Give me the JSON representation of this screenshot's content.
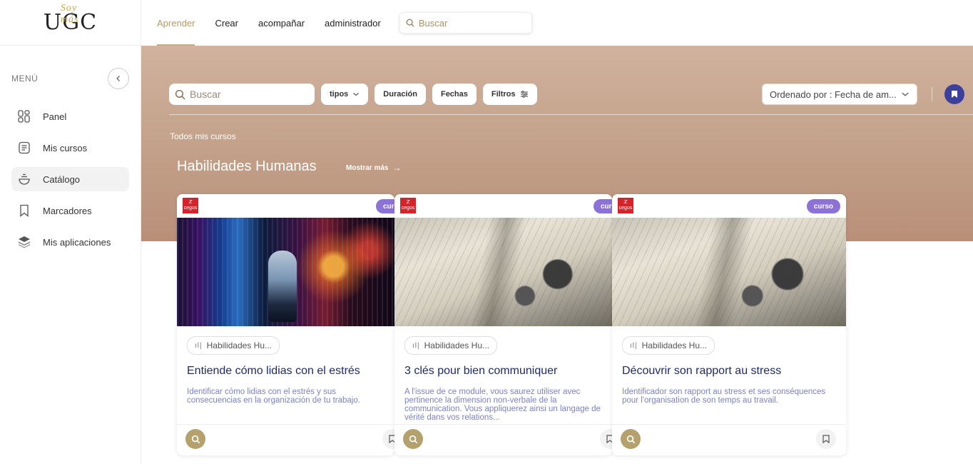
{
  "logo": {
    "letters": "UGC",
    "script": "Soy más"
  },
  "sidebar": {
    "menu_title": "MENÚ",
    "items": [
      {
        "label": "Panel",
        "icon": "dashboard-icon"
      },
      {
        "label": "Mis cursos",
        "icon": "courses-icon"
      },
      {
        "label": "Catálogo",
        "icon": "catalog-icon",
        "active": true
      },
      {
        "label": "Marcadores",
        "icon": "bookmark-icon"
      },
      {
        "label": "Mis aplicaciones",
        "icon": "apps-icon"
      }
    ]
  },
  "topnav": {
    "items": [
      "Aprender",
      "Crear",
      "acompañar",
      "administrador"
    ],
    "active": "Aprender",
    "search_placeholder": "Buscar"
  },
  "filters": {
    "search_placeholder": "Buscar",
    "types": "tipos",
    "duration": "Duración",
    "dates": "Fechas",
    "filters": "Filtros",
    "sort": "Ordenado por : Fecha de am..."
  },
  "section": {
    "all_courses": "Todos mis cursos",
    "title": "Habilidades Humanas",
    "show_more": "Mostrar más"
  },
  "cards": [
    {
      "badge": "curso",
      "category": "Habilidades Hu...",
      "title": "Entiende cómo lidias con el estrés",
      "description": "Identificar cómo lidias con el estrés y sus consecuencias en la organización de tu trabajo."
    },
    {
      "badge": "curso",
      "category": "Habilidades Hu...",
      "title": "3 clés pour bien communiquer",
      "description": "A l'issue de ce module, vous saurez utiliser avec pertinence la dimension non-verbale de la communication. Vous appliquerez ainsi un langage de vérité dans vos relations..."
    },
    {
      "badge": "curso",
      "category": "Habilidades Hu...",
      "title": "Découvrir son rapport au stress",
      "description": "Identificador son rapport au stress et ses conséquences pour l'organisation de son temps au travail."
    }
  ],
  "brand_badge": {
    "line1": "ℤ",
    "line2": "cegos"
  },
  "colors": {
    "accent_gold": "#b5a16e",
    "primary_navy": "#3d3f9c",
    "title_navy": "#1e2a6e",
    "badge_purple": "#8c72d6",
    "banner_tan": "#c6a58e"
  }
}
